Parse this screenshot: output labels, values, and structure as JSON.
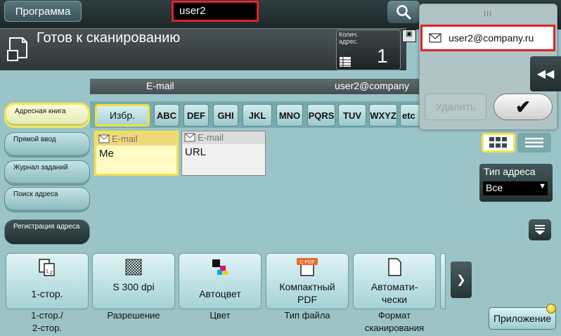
{
  "header": {
    "program_label": "Программа",
    "user_field": "user2"
  },
  "status": {
    "title": "Готов к сканированию",
    "count_label": "Колич. адрес.",
    "count_value": "1"
  },
  "address_tab": {
    "left_label": "E-mail",
    "right_label": "user2@company"
  },
  "sidebar": {
    "items": [
      {
        "label": "Адресная книга"
      },
      {
        "label": "Прямой ввод"
      },
      {
        "label": "Журнал заданий"
      },
      {
        "label": "Поиск адреса"
      },
      {
        "label": "Регистрация адреса"
      }
    ]
  },
  "index": {
    "favorites_label": "Избр.",
    "letters": [
      "ABC",
      "DEF",
      "GHI",
      "JKL",
      "MNO",
      "PQRS",
      "TUV",
      "WXYZ",
      "etc"
    ]
  },
  "entries": [
    {
      "type": "E-mail",
      "name": "Me"
    },
    {
      "type": "E-mail",
      "name": "URL"
    }
  ],
  "panel": {
    "grip": "III",
    "selected_email": "user2@company.ru",
    "delete_label": "Удалить",
    "ok_label": "✔",
    "collapse_label": "◀◀"
  },
  "address_type": {
    "label": "Тип адреса",
    "value": "Все"
  },
  "settings": [
    {
      "value": "1-стор.",
      "label": "1-стор./\n2-стор."
    },
    {
      "value": "S 300 dpi",
      "label": "Разрешение"
    },
    {
      "value": "Автоцвет",
      "label": "Цвет"
    },
    {
      "value": "Компактный\nPDF",
      "label": "Тип файла"
    },
    {
      "value": "Автомати-\nчески",
      "label": "Формат\nсканирования"
    }
  ],
  "icons": {
    "pdf_badge": "C-PDF",
    "search_partial": "П\nФ"
  },
  "app_label": "Приложение",
  "colors": {
    "accent_yellow": "#f2e44c",
    "highlight_red": "#e0212a",
    "background_teal": "#9ac4c8"
  }
}
